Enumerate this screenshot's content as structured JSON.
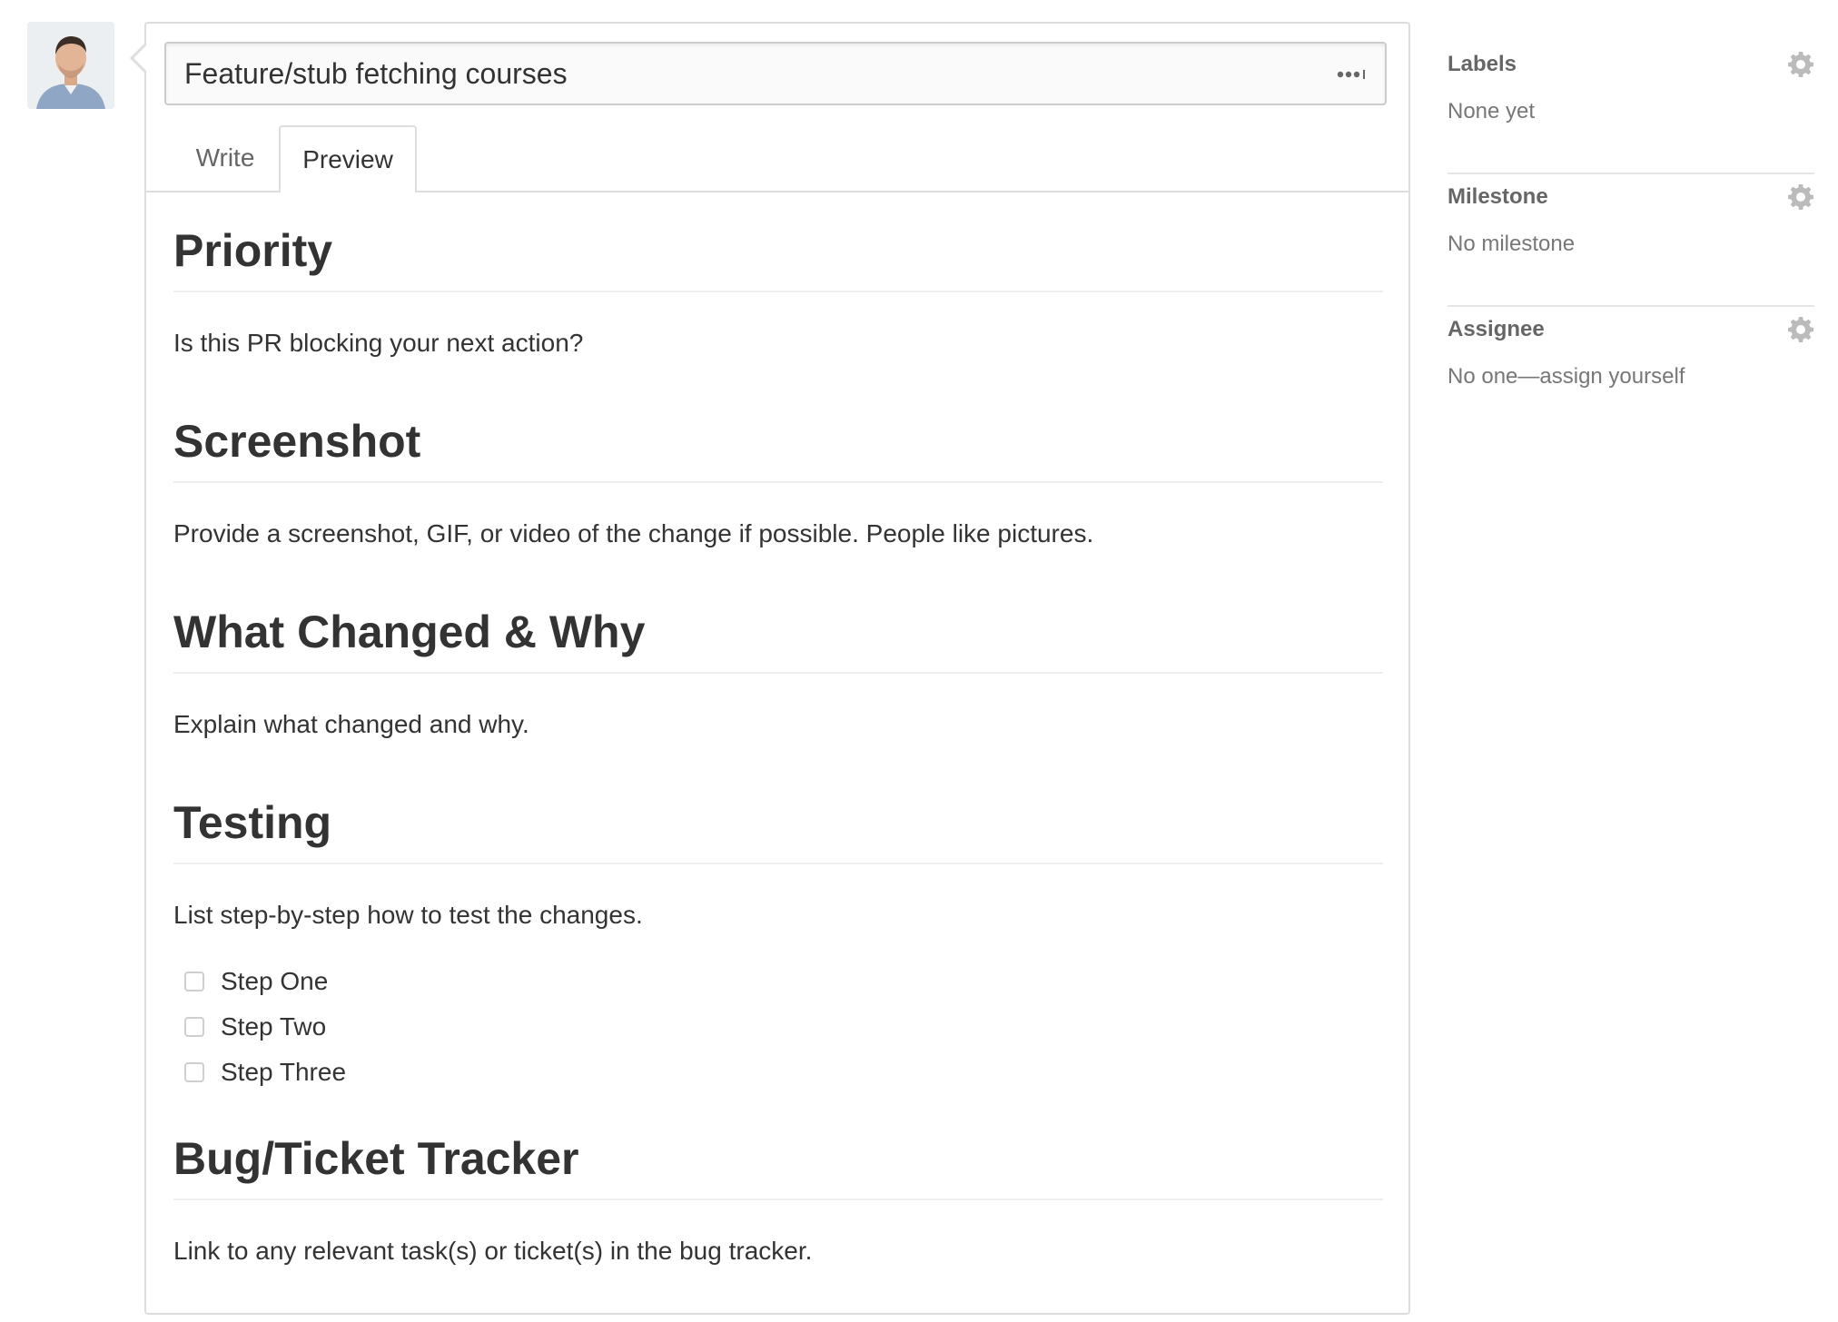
{
  "title_input": {
    "value": "Feature/stub fetching courses"
  },
  "tabs": [
    {
      "label": "Write",
      "active": false
    },
    {
      "label": "Preview",
      "active": true
    }
  ],
  "preview": {
    "sections": [
      {
        "heading": "Priority",
        "text": "Is this PR blocking your next action?"
      },
      {
        "heading": "Screenshot",
        "text": "Provide a screenshot, GIF, or video of the change if possible. People like pictures."
      },
      {
        "heading": "What Changed & Why",
        "text": "Explain what changed and why."
      },
      {
        "heading": "Testing",
        "text": "List step-by-step how to test the changes."
      },
      {
        "heading": "Bug/Ticket Tracker",
        "text": "Link to any relevant task(s) or ticket(s) in the bug tracker."
      }
    ],
    "tasks": [
      {
        "label": "Step One",
        "checked": false
      },
      {
        "label": "Step Two",
        "checked": false
      },
      {
        "label": "Step Three",
        "checked": false
      }
    ]
  },
  "sidebar": {
    "labels": {
      "heading": "Labels",
      "value": "None yet",
      "icon": "gear-icon"
    },
    "milestone": {
      "heading": "Milestone",
      "value": "No milestone",
      "icon": "gear-icon"
    },
    "assignee": {
      "heading": "Assignee",
      "value": "No one—assign yourself",
      "icon": "gear-icon"
    }
  },
  "colors": {
    "border": "#dddddd",
    "text": "#333333",
    "muted": "#777777",
    "icon": "#bbbbbb"
  }
}
